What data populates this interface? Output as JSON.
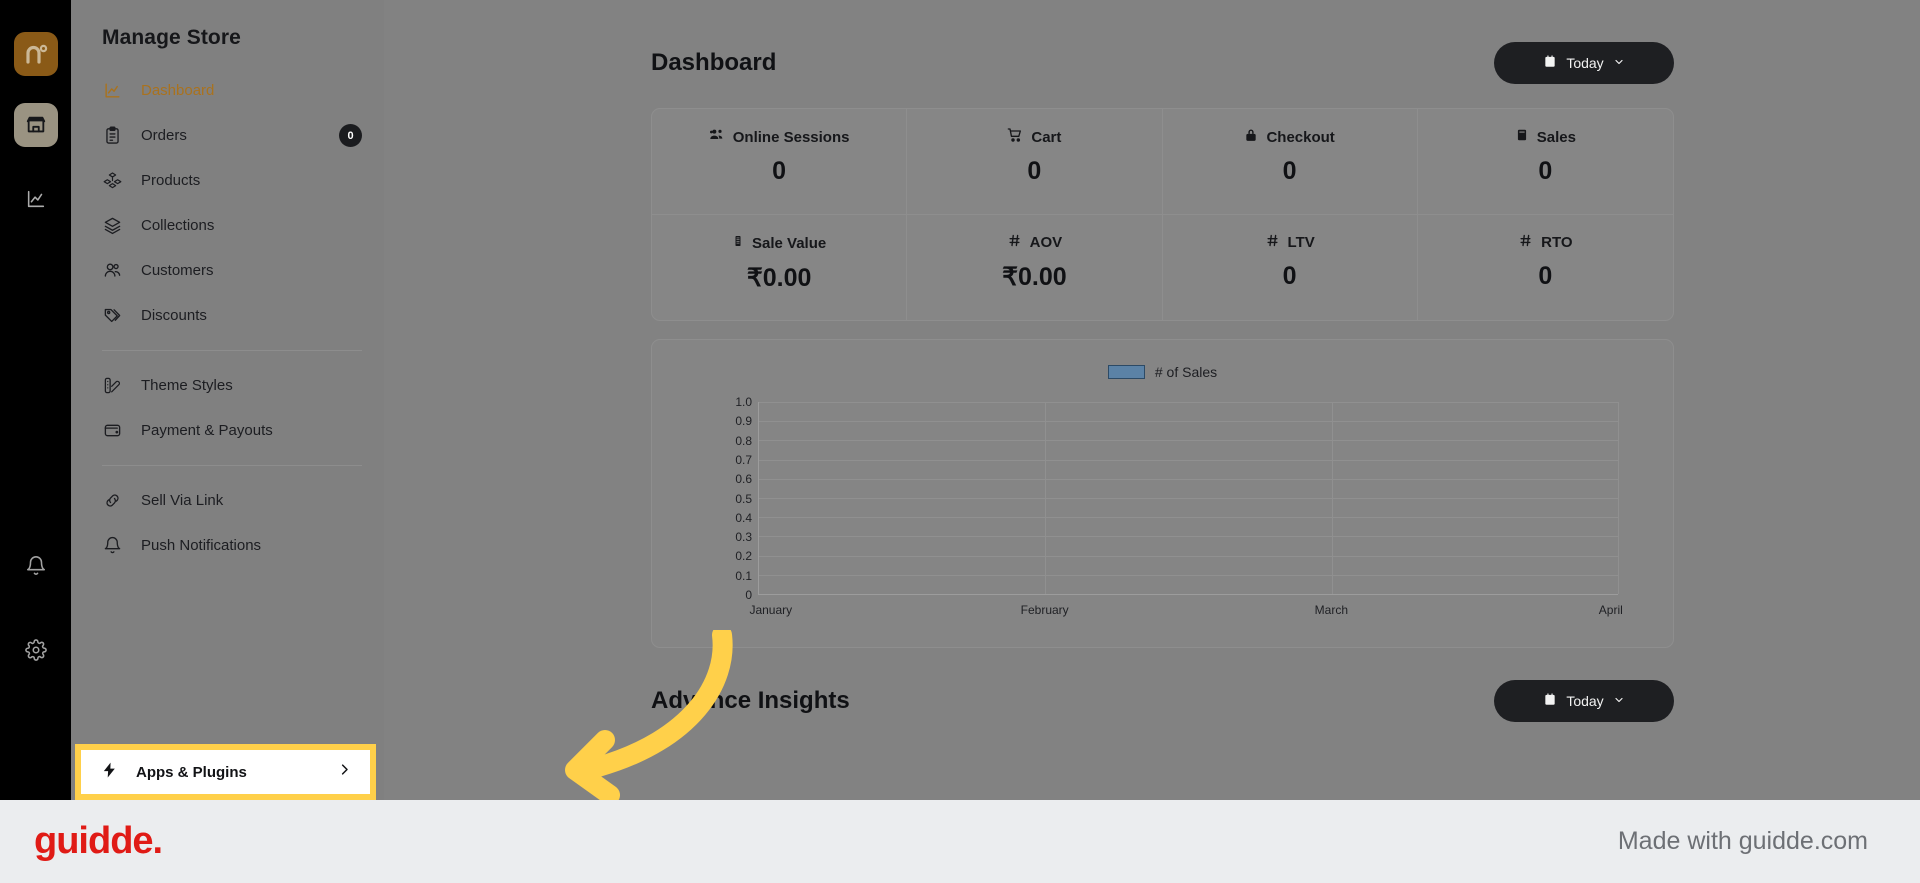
{
  "rail": {
    "logo_icon": "brand-n-logo-icon",
    "items": [
      {
        "icon": "store-icon",
        "name": "store-rail-button",
        "active": true
      },
      {
        "icon": "analytics-chart-icon",
        "name": "analytics-rail-button",
        "active": false
      }
    ],
    "bottom": [
      {
        "icon": "bell-icon",
        "name": "notifications-rail-button"
      },
      {
        "icon": "gear-icon",
        "name": "settings-rail-button"
      }
    ]
  },
  "sidebar": {
    "title": "Manage Store",
    "groups": [
      {
        "items": [
          {
            "label": "Dashboard",
            "icon": "line-chart-icon",
            "active": true,
            "badge": ""
          },
          {
            "label": "Orders",
            "icon": "clipboard-list-icon",
            "active": false,
            "badge": "0"
          },
          {
            "label": "Products",
            "icon": "boxes-icon",
            "active": false,
            "badge": ""
          },
          {
            "label": "Collections",
            "icon": "layers-icon",
            "active": false,
            "badge": ""
          },
          {
            "label": "Customers",
            "icon": "users-icon",
            "active": false,
            "badge": ""
          },
          {
            "label": "Discounts",
            "icon": "tags-icon",
            "active": false,
            "badge": ""
          }
        ]
      },
      {
        "items": [
          {
            "label": "Theme Styles",
            "icon": "palette-icon",
            "active": false,
            "badge": ""
          },
          {
            "label": "Payment & Payouts",
            "icon": "wallet-icon",
            "active": false,
            "badge": ""
          }
        ]
      },
      {
        "items": [
          {
            "label": "Sell Via Link",
            "icon": "link-icon",
            "active": false,
            "badge": ""
          },
          {
            "label": "Push Notifications",
            "icon": "bell-icon",
            "active": false,
            "badge": ""
          }
        ]
      }
    ],
    "apps_plugins": {
      "label": "Apps & Plugins",
      "icon": "lightning-bolt-icon",
      "chevron_icon": "chevron-right-icon",
      "highlight_color": "#ffd04a"
    }
  },
  "main": {
    "page_title": "Dashboard",
    "date_filter": {
      "label": "Today",
      "calendar_icon": "calendar-icon",
      "chevron_icon": "chevron-down-icon"
    },
    "stats": [
      {
        "label": "Online Sessions",
        "value": "0",
        "icon": "people-group-icon"
      },
      {
        "label": "Cart",
        "value": "0",
        "icon": "shopping-cart-icon"
      },
      {
        "label": "Checkout",
        "value": "0",
        "icon": "lock-icon"
      },
      {
        "label": "Sales",
        "value": "0",
        "icon": "receipt-icon"
      },
      {
        "label": "Sale Value",
        "value": "₹0.00",
        "icon": "bill-icon"
      },
      {
        "label": "AOV",
        "value": "₹0.00",
        "icon": "hash-icon"
      },
      {
        "label": "LTV",
        "value": "0",
        "icon": "hash-icon"
      },
      {
        "label": "RTO",
        "value": "0",
        "icon": "hash-icon"
      }
    ],
    "insights_title": "Advance Insights",
    "insights_date_filter": {
      "label": "Today",
      "calendar_icon": "calendar-icon",
      "chevron_icon": "chevron-down-icon"
    }
  },
  "chart_data": {
    "type": "bar",
    "title": "",
    "legend": [
      "# of Sales"
    ],
    "legend_position": "top-center",
    "legend_color": "#5b82a6",
    "categories": [
      "January",
      "February",
      "March",
      "April"
    ],
    "series": [
      {
        "name": "# of Sales",
        "values": [
          0,
          0,
          0,
          0
        ]
      }
    ],
    "xlabel": "",
    "ylabel": "",
    "ylim": [
      0,
      1.0
    ],
    "yticks": [
      "1.0",
      "0.9",
      "0.8",
      "0.7",
      "0.6",
      "0.5",
      "0.4",
      "0.3",
      "0.2",
      "0.1",
      "0"
    ],
    "grid": true
  },
  "footer": {
    "logo_text": "guidde.",
    "made_with": "Made with guidde.com",
    "logo_color": "#e01b16"
  }
}
